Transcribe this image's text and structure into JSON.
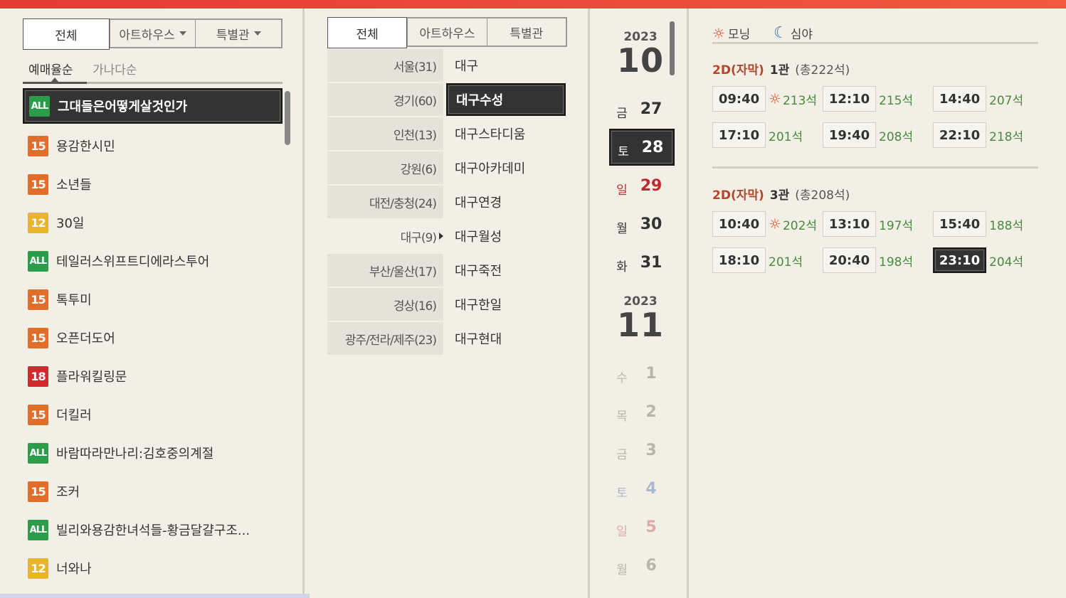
{
  "movie_tabs": [
    {
      "label": "전체",
      "active": true,
      "caret": false
    },
    {
      "label": "아트하우스",
      "active": false,
      "caret": true
    },
    {
      "label": "특별관",
      "active": false,
      "caret": true
    }
  ],
  "sort": {
    "by_booking": "예매율순",
    "by_name": "가나다순"
  },
  "movies": [
    {
      "rating": "ALL",
      "rating_class": "b-all",
      "title": "그대들은어떻게살것인가",
      "active": true
    },
    {
      "rating": "15",
      "rating_class": "b-15",
      "title": "용감한시민"
    },
    {
      "rating": "15",
      "rating_class": "b-15",
      "title": "소년들"
    },
    {
      "rating": "12",
      "rating_class": "b-12",
      "title": "30일"
    },
    {
      "rating": "ALL",
      "rating_class": "b-all",
      "title": "테일러스위프트디에라스투어"
    },
    {
      "rating": "15",
      "rating_class": "b-15",
      "title": "톡투미"
    },
    {
      "rating": "15",
      "rating_class": "b-15",
      "title": "오픈더도어"
    },
    {
      "rating": "18",
      "rating_class": "b-18",
      "title": "플라워킬링문"
    },
    {
      "rating": "15",
      "rating_class": "b-15",
      "title": "더킬러"
    },
    {
      "rating": "ALL",
      "rating_class": "b-all",
      "title": "바람따라만나리:김호중의계절"
    },
    {
      "rating": "15",
      "rating_class": "b-15",
      "title": "조커"
    },
    {
      "rating": "ALL",
      "rating_class": "b-all",
      "title": "빌리와용감한녀석들-황금달걀구조..."
    },
    {
      "rating": "12",
      "rating_class": "b-12",
      "title": "너와나"
    }
  ],
  "theater_tabs": [
    {
      "label": "전체",
      "active": true
    },
    {
      "label": "아트하우스",
      "active": false
    },
    {
      "label": "특별관",
      "active": false
    }
  ],
  "regions": [
    {
      "label": "서울(31)",
      "shaded": true
    },
    {
      "label": "경기(60)",
      "shaded": true
    },
    {
      "label": "인천(13)",
      "shaded": true
    },
    {
      "label": "강원(6)",
      "shaded": true
    },
    {
      "label": "대전/충청(24)",
      "shaded": true
    },
    {
      "label": "대구(9)",
      "shaded": false,
      "selected": true
    },
    {
      "label": "부산/울산(17)",
      "shaded": true
    },
    {
      "label": "경상(16)",
      "shaded": true
    },
    {
      "label": "광주/전라/제주(23)",
      "shaded": true
    }
  ],
  "branches": [
    {
      "label": "대구"
    },
    {
      "label": "대구수성",
      "active": true
    },
    {
      "label": "대구스타디움"
    },
    {
      "label": "대구아카데미"
    },
    {
      "label": "대구연경"
    },
    {
      "label": "대구월성"
    },
    {
      "label": "대구죽전"
    },
    {
      "label": "대구한일"
    },
    {
      "label": "대구현대"
    }
  ],
  "months": [
    {
      "year": "2023",
      "month": "10"
    },
    {
      "year": "2023",
      "month": "11"
    }
  ],
  "dates_oct": [
    {
      "weekday": "금",
      "day": "27",
      "color": "#333333",
      "wcolor": "#333333"
    },
    {
      "weekday": "토",
      "day": "28",
      "color": "#ffffff",
      "wcolor": "#ffffff",
      "active": true
    },
    {
      "weekday": "일",
      "day": "29",
      "color": "#c0282d",
      "wcolor": "#c0282d"
    },
    {
      "weekday": "월",
      "day": "30",
      "color": "#333333",
      "wcolor": "#333333"
    },
    {
      "weekday": "화",
      "day": "31",
      "color": "#333333",
      "wcolor": "#333333"
    }
  ],
  "dates_nov": [
    {
      "weekday": "수",
      "day": "1",
      "color": "#b8b5aa",
      "wcolor": "#b8b5aa"
    },
    {
      "weekday": "목",
      "day": "2",
      "color": "#b8b5aa",
      "wcolor": "#b8b5aa"
    },
    {
      "weekday": "금",
      "day": "3",
      "color": "#b8b5aa",
      "wcolor": "#b8b5aa"
    },
    {
      "weekday": "토",
      "day": "4",
      "color": "#a9b9cc",
      "wcolor": "#a9b9cc"
    },
    {
      "weekday": "일",
      "day": "5",
      "color": "#e2a8a6",
      "wcolor": "#e2a8a6"
    },
    {
      "weekday": "월",
      "day": "6",
      "color": "#b8b5aa",
      "wcolor": "#b8b5aa"
    }
  ],
  "legend": {
    "morning": "모닝",
    "late_night": "심야"
  },
  "halls": [
    {
      "format": "2D(자막)",
      "name": "1관",
      "total": "(총222석)",
      "slots": [
        {
          "time": "09:40",
          "seats": "213석",
          "morning": true
        },
        {
          "time": "12:10",
          "seats": "215석"
        },
        {
          "time": "14:40",
          "seats": "207석"
        },
        {
          "time": "17:10",
          "seats": "201석"
        },
        {
          "time": "19:40",
          "seats": "208석"
        },
        {
          "time": "22:10",
          "seats": "218석"
        }
      ]
    },
    {
      "format": "2D(자막)",
      "name": "3관",
      "total": "(총208석)",
      "slots": [
        {
          "time": "10:40",
          "seats": "202석",
          "morning": true
        },
        {
          "time": "13:10",
          "seats": "197석"
        },
        {
          "time": "15:40",
          "seats": "188석"
        },
        {
          "time": "18:10",
          "seats": "201석"
        },
        {
          "time": "20:40",
          "seats": "198석"
        },
        {
          "time": "23:10",
          "seats": "204석",
          "active": true
        }
      ]
    }
  ]
}
